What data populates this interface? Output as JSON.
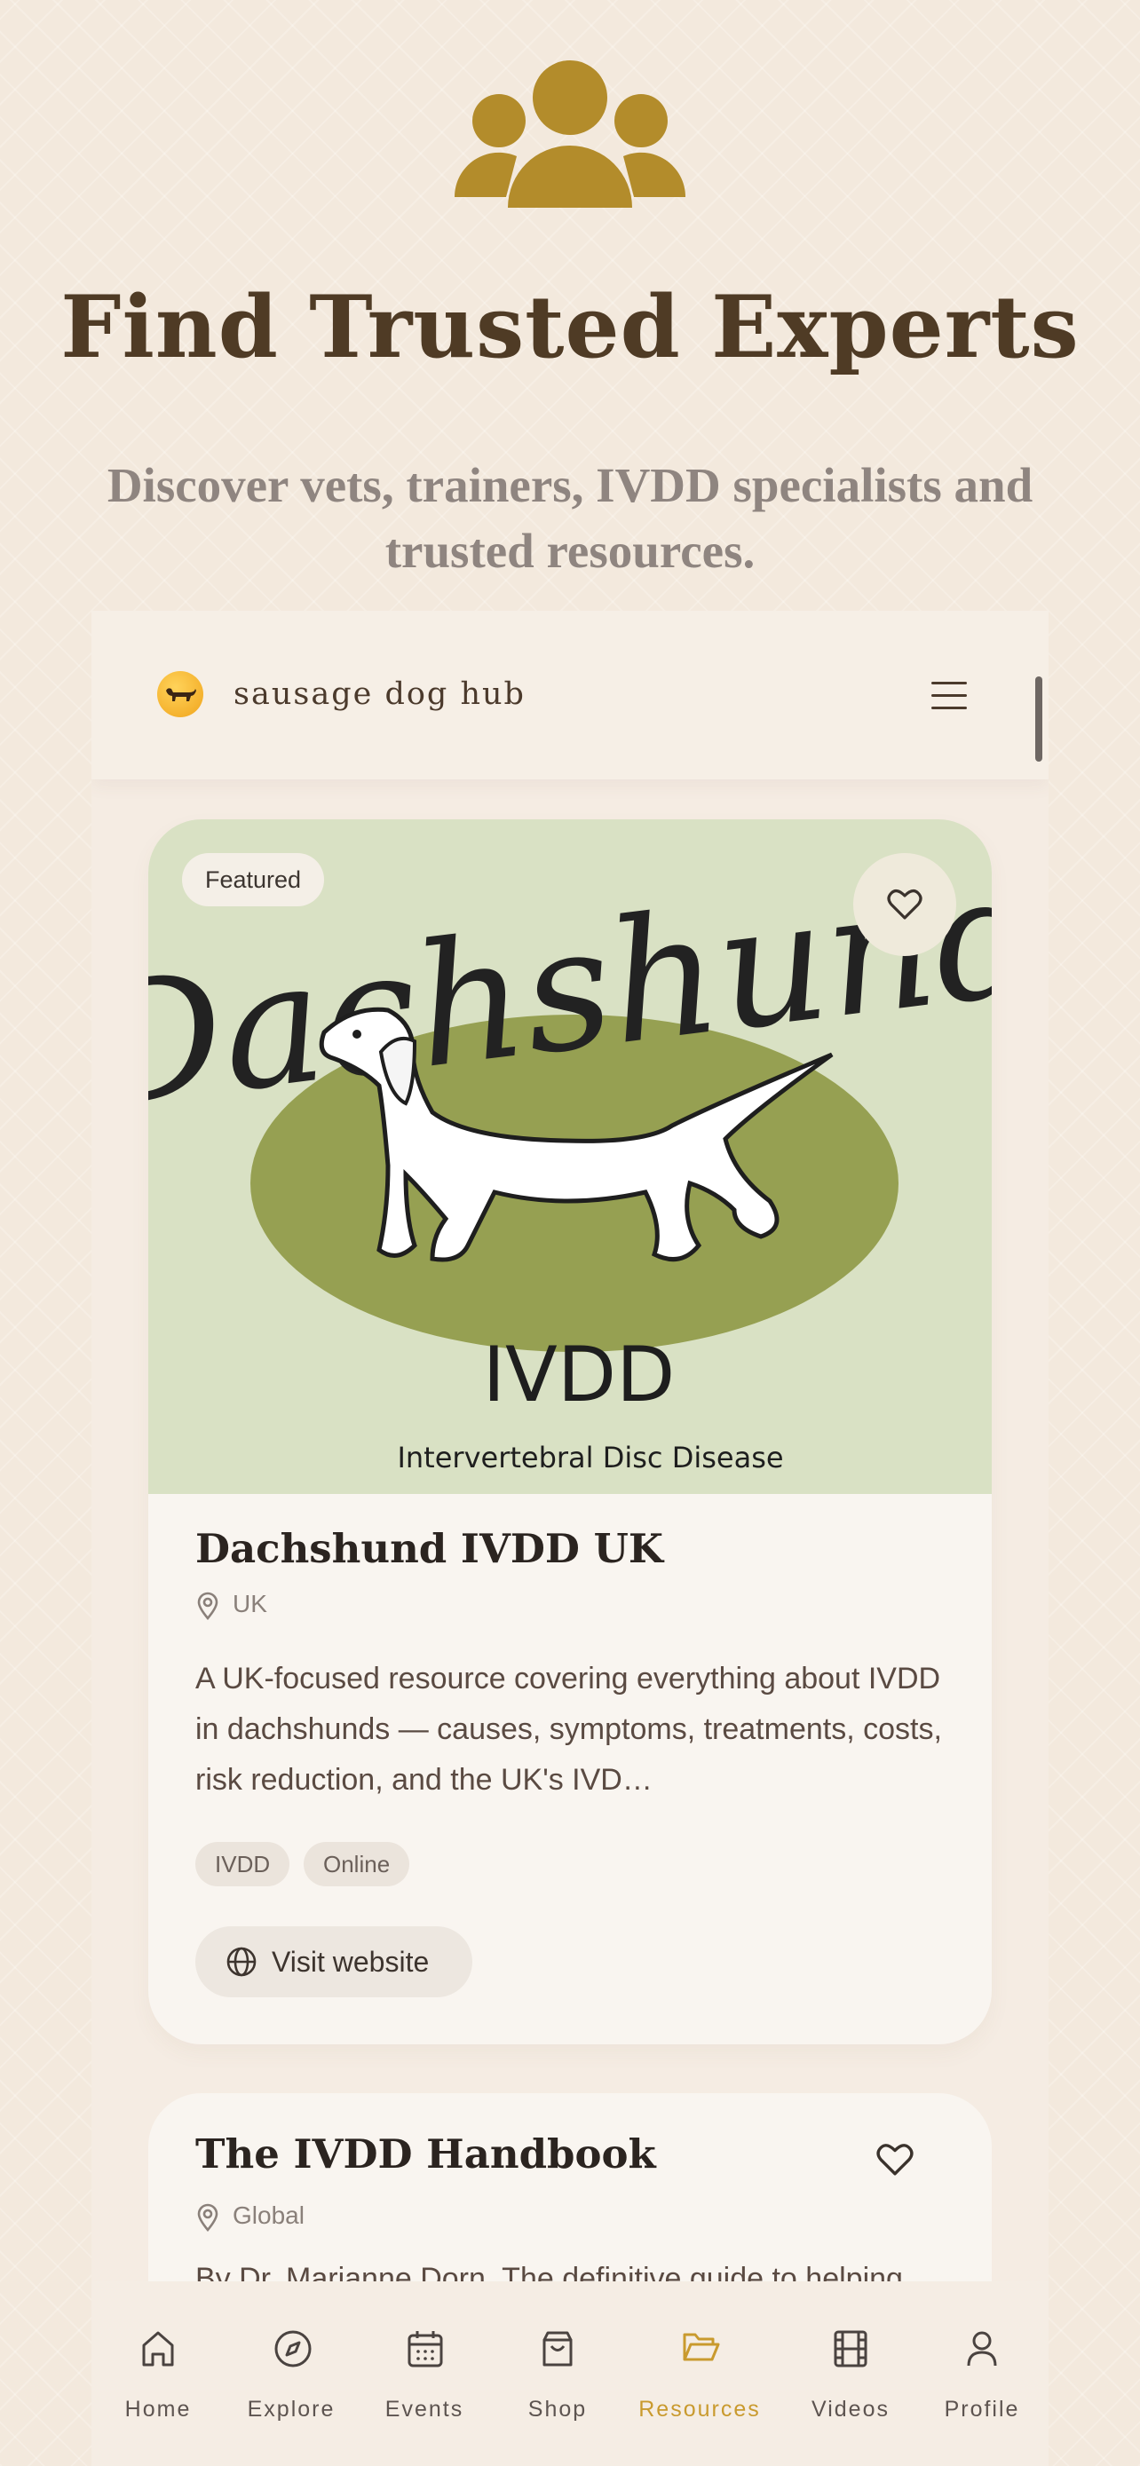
{
  "hero": {
    "title": "Find Trusted Experts",
    "subtitle": "Discover vets, trainers, IVDD specialists and trusted resources.",
    "icon": "people-group-icon",
    "accent_color": "#b38c2b"
  },
  "appbar": {
    "brand": "sausage dog hub",
    "logo_icon": "dachshund-logo-icon",
    "menu_icon": "hamburger-menu-icon"
  },
  "cards": [
    {
      "badge": "Featured",
      "image_text": {
        "headline": "Dachshund",
        "sub": "IVDD",
        "caption": "Intervertebral Disc Disease"
      },
      "title": "Dachshund IVDD UK",
      "location": "UK",
      "description": "A UK-focused resource covering everything about IVDD in dachshunds — causes, symptoms, treatments, costs, risk reduction, and the UK's IVD…",
      "tags": [
        "IVDD",
        "Online"
      ],
      "action": "Visit website"
    },
    {
      "title": "The IVDD Handbook",
      "location": "Global",
      "description": "By Dr. Marianne Dorn. The definitive guide to helping"
    }
  ],
  "nav": {
    "items": [
      {
        "label": "Home",
        "icon": "home-icon"
      },
      {
        "label": "Explore",
        "icon": "compass-icon"
      },
      {
        "label": "Events",
        "icon": "calendar-icon"
      },
      {
        "label": "Shop",
        "icon": "shopping-bag-icon"
      },
      {
        "label": "Resources",
        "icon": "folder-open-icon",
        "active": true
      },
      {
        "label": "Videos",
        "icon": "film-icon"
      },
      {
        "label": "Profile",
        "icon": "user-icon"
      }
    ],
    "active_color": "#c99a2e"
  }
}
